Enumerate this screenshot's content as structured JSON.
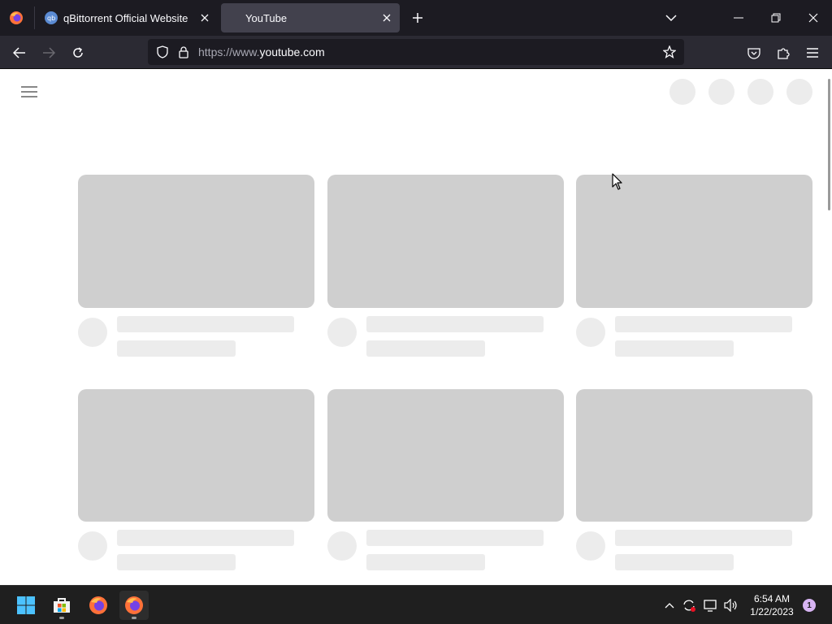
{
  "browser": {
    "tabs": [
      {
        "title": "qBittorrent Official Website",
        "favicon": "qbittorrent-icon",
        "active": false
      },
      {
        "title": "YouTube",
        "favicon": "",
        "active": true
      }
    ],
    "address": {
      "prefix": "https://www.",
      "domain": "youtube.com"
    },
    "icons": {
      "menu": "firefox-icon",
      "new_tab": "plus-icon",
      "tab_list": "chevron-down-icon",
      "minimize": "minimize-icon",
      "restore": "restore-icon",
      "close": "close-icon",
      "back": "back-arrow-icon",
      "forward": "forward-arrow-icon",
      "reload": "reload-icon",
      "tracking": "shield-icon",
      "lock": "lock-icon",
      "bookmark": "star-icon",
      "pocket": "pocket-icon",
      "extensions": "extensions-icon",
      "app_menu": "hamburger-menu-icon"
    }
  },
  "page": {
    "state": "loading-skeleton",
    "skeleton_color": "#cfcfcf",
    "placeholder_color": "#ececec"
  },
  "taskbar": {
    "apps": [
      "windows-start-icon",
      "microsoft-store-icon",
      "firefox-icon",
      "firefox-icon"
    ],
    "tray": [
      "chevron-up-icon",
      "sync-icon",
      "network-icon",
      "volume-icon"
    ],
    "time": "6:54 AM",
    "date": "1/22/2023",
    "notification_count": "1",
    "notification_color": "#d7b4f3"
  }
}
